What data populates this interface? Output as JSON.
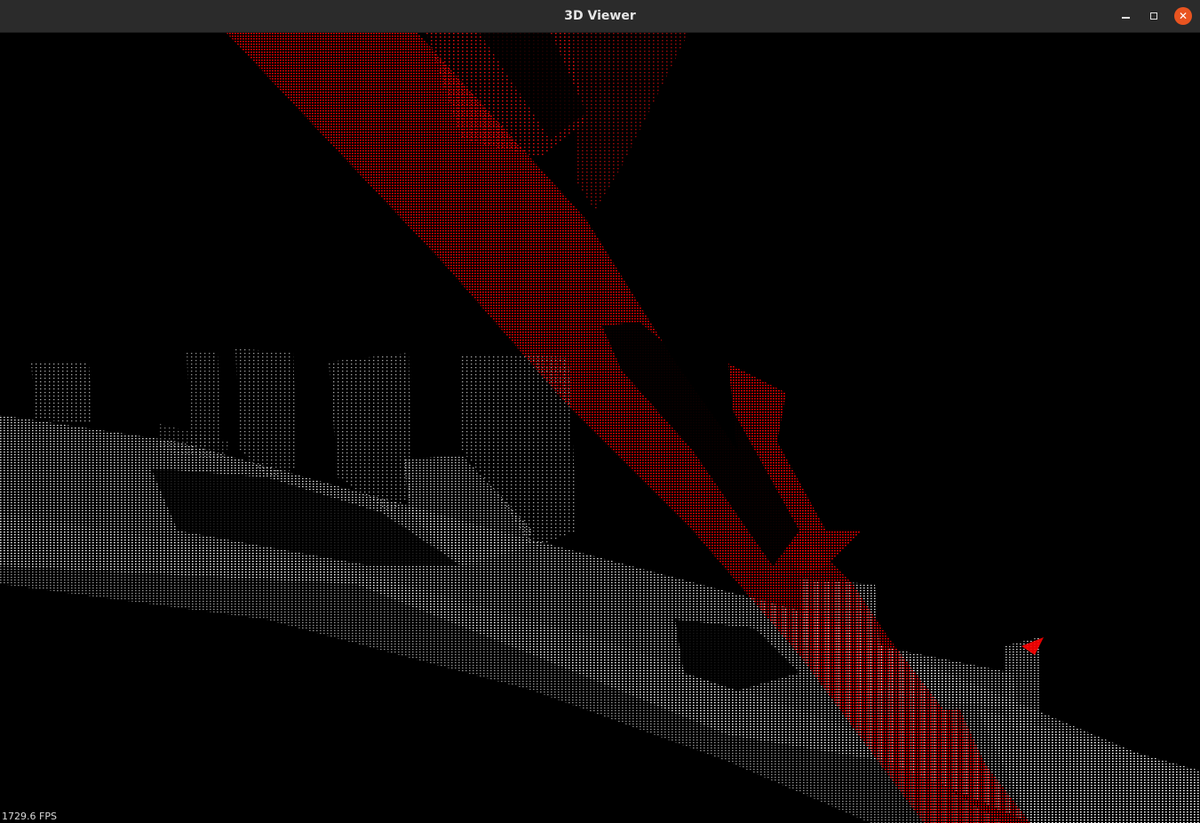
{
  "window": {
    "title": "3D Viewer",
    "controls": {
      "minimize": "minimize-icon",
      "maximize": "maximize-icon",
      "close": "close-icon"
    }
  },
  "viewport": {
    "background": "#000000",
    "point_colors": {
      "highlight": "#ff0000",
      "scene": "#ffffff"
    }
  },
  "status": {
    "fps_text": "1729.6 FPS"
  }
}
